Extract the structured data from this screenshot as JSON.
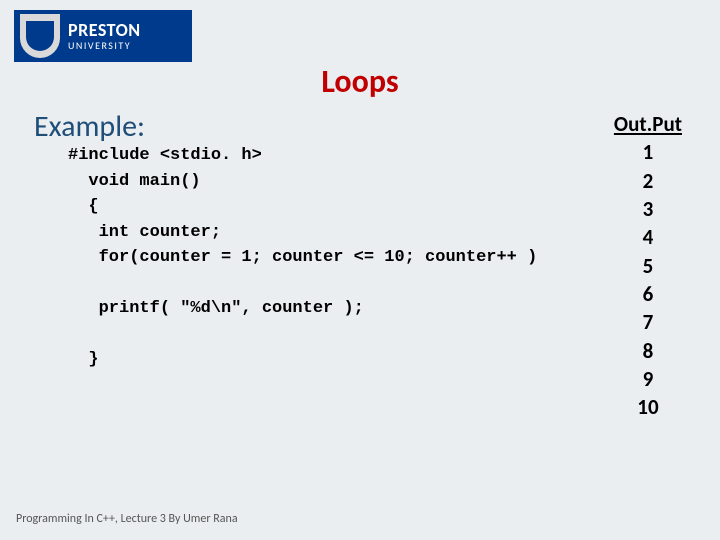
{
  "logo": {
    "name": "PRESTON",
    "sub": "UNIVERSITY"
  },
  "title": "Loops",
  "subtitle": "Example:",
  "code": {
    "l1": "#include <stdio. h>",
    "l2": "  void main()",
    "l3": "  {",
    "l4": "   int counter;",
    "l5": "   for(counter = 1; counter <= 10; counter++ )",
    "l6": "",
    "l7": "   printf( \"%d\\n\", counter );",
    "l8": "",
    "l9": "  }"
  },
  "output": {
    "heading": "Out.Put",
    "values": [
      "1",
      "2",
      "3",
      "4",
      "5",
      "6",
      "7",
      "8",
      "9",
      "10"
    ]
  },
  "footer": "Programming In C++, Lecture 3 By Umer Rana"
}
